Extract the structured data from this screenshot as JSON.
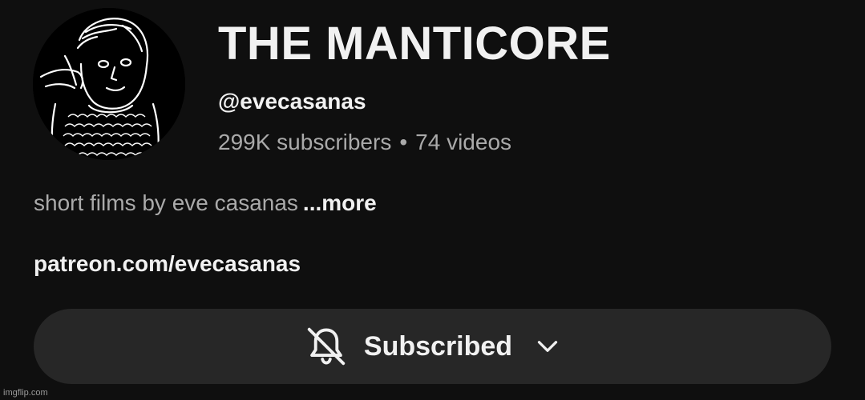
{
  "channel": {
    "title": "THE MANTICORE",
    "handle": "@evecasanas",
    "subscribers": "299K subscribers",
    "separator": "•",
    "videos": "74 videos"
  },
  "description": {
    "text": "short films by eve casanas",
    "more_label": "...more"
  },
  "link": {
    "text": "patreon.com/evecasanas"
  },
  "subscribe": {
    "label": "Subscribed",
    "bell_icon": "bell-off-icon",
    "chevron_icon": "chevron-down-icon"
  },
  "watermark": "imgflip.com",
  "colors": {
    "background": "#0f0f0f",
    "button_background": "#272727",
    "primary_text": "#f1f1f1",
    "secondary_text": "#aaaaaa"
  }
}
